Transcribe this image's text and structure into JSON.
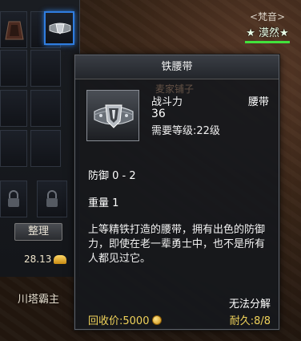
{
  "inventory": {
    "sort_label": "整理",
    "gold_amount": "28.13"
  },
  "world": {
    "bottom_name": "川塔霸主"
  },
  "player": {
    "guild": "<梵音>",
    "name": "★ 漠然★",
    "hp_fraction": 1.0
  },
  "tooltip": {
    "title": "铁腰带",
    "shop_ghost": "麦家铺子",
    "power_label": "战斗力",
    "power_value": "36",
    "required_level": "需要等级:22级",
    "item_type": "腰带",
    "defense": "防御 0 - 2",
    "weight": "重量 1",
    "description": "上等精铁打造的腰带，拥有出色的防御力，即使在老一辈勇士中，也不是所有人都见过它。",
    "no_dismantle": "无法分解",
    "recycle_price": "回收价:5000",
    "durability": "耐久:8/8"
  },
  "icons": {
    "item": "iron-belt-icon",
    "coin": "gold-coin-icon",
    "gold": "gold-ingot-icon",
    "lock": "lock-icon"
  }
}
